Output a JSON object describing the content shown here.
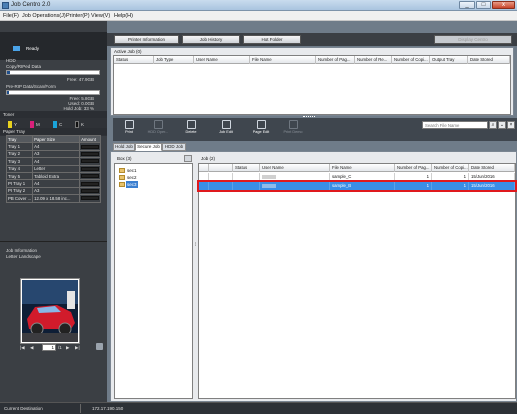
{
  "window": {
    "title": "Job Centro 2.0",
    "min": "_",
    "max": "□",
    "close": "x"
  },
  "menu": [
    "File(F)",
    "Job Operations(J)",
    "Printer(P)",
    "View(V)",
    "Help(H)"
  ],
  "status": {
    "state": "Ready"
  },
  "hdd": {
    "heading": "HDD",
    "copy_label": "Copy/RIPed Data",
    "free": "Free: 47.9GB",
    "pre_rip_label": "Pre-RIP Data/Scan/Form",
    "free2": "Free: 5.8GB",
    "used": "Used: 0.0GB",
    "hold_job": "Hold Job: 33 %"
  },
  "toner": {
    "heading": "Toner",
    "labels": [
      "Y",
      "M",
      "C",
      "K"
    ],
    "colors": [
      "#e8d21f",
      "#d8207a",
      "#1aa3d9",
      "#111111"
    ]
  },
  "paper_tray": {
    "heading": "Paper Tray",
    "columns": [
      "Tray",
      "Paper Size",
      "Amount"
    ],
    "rows": [
      [
        "Tray 1",
        "A4"
      ],
      [
        "Tray 2",
        "A3"
      ],
      [
        "Tray 3",
        "A4"
      ],
      [
        "Tray 4",
        "Letter"
      ],
      [
        "Tray 5",
        "Tabloid Extra"
      ],
      [
        "PI Tray 1",
        "A4"
      ],
      [
        "PI Tray 2",
        "A3"
      ],
      [
        "PB Cover ...",
        "12.09 x 18.58 inc..."
      ]
    ]
  },
  "job_info": {
    "heading": "Job Information",
    "paper": "Letter Landscape",
    "page": "1",
    "page_total": "/1"
  },
  "top_buttons": [
    "Printer Information",
    "Job History",
    "Hot Folder",
    "Display Centro"
  ],
  "active_job": {
    "label": "Active Job (0)",
    "columns": [
      "Status",
      "Job Type",
      "User Name",
      "File Name",
      "Number of Pag...",
      "Number of Re...",
      "Number of Copi...",
      "Output Tray",
      "Date Stored"
    ]
  },
  "toolbar": {
    "items": [
      "Print",
      "HDD Oper...",
      "Delete",
      "Job Edit",
      "Page Edit",
      "Print Demo"
    ],
    "search_placeholder": "Search File Name"
  },
  "tabs": [
    "Hold Job",
    "Secure Job",
    "HDD Job"
  ],
  "box": {
    "label": "Box (3)",
    "items": [
      "sec1",
      "sec2",
      "sec3"
    ]
  },
  "job": {
    "label": "Job (2)",
    "columns": [
      "Status",
      "User Name",
      "File Name",
      "Number of Pag...",
      "Number of Copi...",
      "Date Stored"
    ],
    "rows": [
      {
        "user": "",
        "file": "sample_C",
        "pages": "1",
        "copies": "1",
        "date": "15/Jun/2016"
      },
      {
        "user": "",
        "file": "sample_B",
        "pages": "1",
        "copies": "1",
        "date": "15/Jun/2016"
      }
    ]
  },
  "statusbar": {
    "label": "Current Destination",
    "ip": "172.17.190.150"
  }
}
